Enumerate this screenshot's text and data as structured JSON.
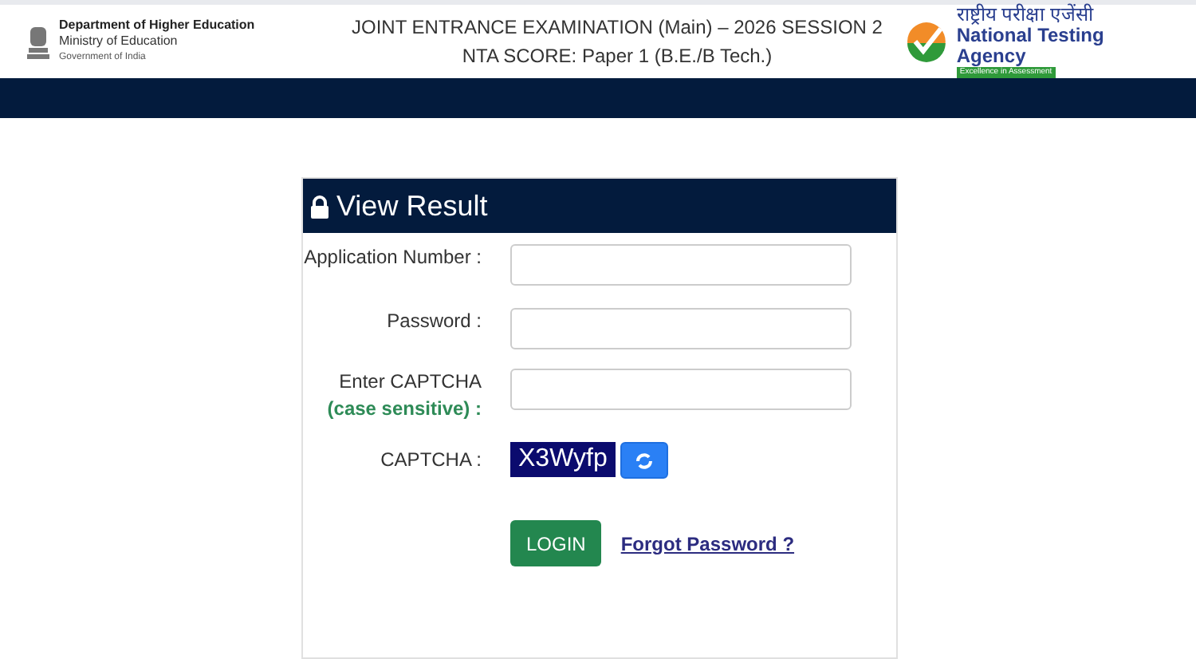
{
  "header": {
    "ministry": {
      "department": "Department of Higher Education",
      "ministry": "Ministry of Education",
      "government": "Government of India"
    },
    "title_lines": [
      "JOINT ENTRANCE EXAMINATION (Main) – 2026 SESSION 2",
      "NTA SCORE: Paper 1 (B.E./B Tech.)"
    ],
    "agency": {
      "hindi": "राष्ट्रीय परीक्षा एजेंसी",
      "english": "National Testing Agency",
      "tagline": "Excellence in Assessment"
    }
  },
  "form": {
    "title": "View Result",
    "fields": [
      {
        "label": "Application Number :"
      },
      {
        "label": "Password :"
      },
      {
        "label": "Enter CAPTCHA",
        "note": "(case sensitive) :"
      }
    ],
    "captcha": {
      "label": "CAPTCHA :",
      "code": "X3Wyfp"
    },
    "login": "LOGIN",
    "forgot": "Forgot Password ?"
  }
}
